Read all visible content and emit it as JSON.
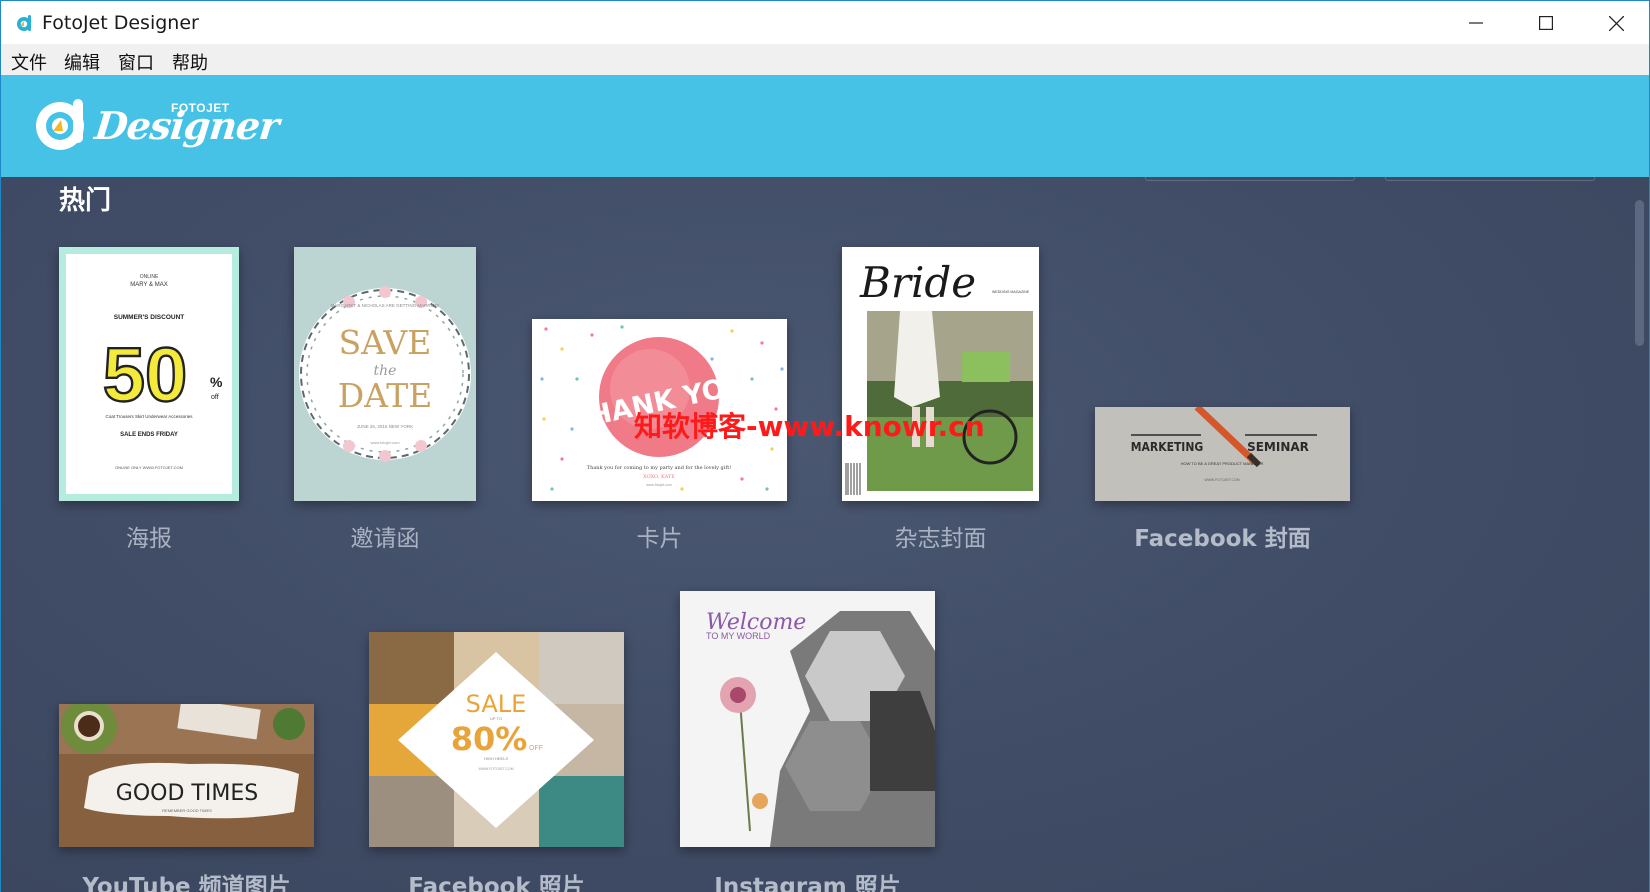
{
  "window": {
    "title": "FotoJet Designer",
    "controls": [
      "minimize",
      "maximize",
      "close"
    ]
  },
  "menu": {
    "items": [
      "文件",
      "编辑",
      "窗口",
      "帮助"
    ]
  },
  "brand": {
    "small_text": "FOTOJET",
    "script_text": "Designer"
  },
  "section": {
    "title": "热门"
  },
  "templates": [
    {
      "label": "海报",
      "thumb": {
        "line1": "ONLINE",
        "line2": "MARY & MAX",
        "line3": "SUMMER'S DISCOUNT",
        "big": "50",
        "percent": "%",
        "off": "off",
        "line4": "Coat  Trousers  Skirt  Underwear  Accessories",
        "line5": "SALE ENDS FRIDAY",
        "line6": "ONLINE ONLY WWW.FOTOJET.COM"
      }
    },
    {
      "label": "邀请函",
      "thumb": {
        "top": "MARGARET & NICHOLAS ARE GETTING MARRIED!",
        "save": "SAVE",
        "the": "the",
        "date": "DATE",
        "when": "JUNE 25, 2016 NEW YORK",
        "site": "www.fotojet.com"
      }
    },
    {
      "label": "卡片",
      "thumb": {
        "big": "THANK YOU",
        "note": "Thank you for coming to my party and for the lovely gift!",
        "sign": "XOXO, KATE",
        "site": "www.fotojet.com"
      }
    },
    {
      "label": "杂志封面",
      "thumb": {
        "title": "Bride",
        "issue": "WEDDING MAGAZINE"
      }
    },
    {
      "label": "Facebook 封面",
      "thumb": {
        "left": "MARKETING",
        "right": "SEMINAR",
        "sub": "HOW TO BE A GREAT PRODUCT MANAGER",
        "site": "WWW.FOTOJET.COM"
      }
    },
    {
      "label": "YouTube 频道图片",
      "thumb": {
        "big": "GOOD TIMES",
        "sub": "REMEMBER GOOD TIMES"
      }
    },
    {
      "label": "Facebook 照片",
      "thumb": {
        "sale": "SALE",
        "upto": "UP TO",
        "pct": "80%",
        "off": "OFF",
        "sub": "HIGH HEELS",
        "site": "WWW.FOTOJET.COM"
      }
    },
    {
      "label": "Instagram 照片",
      "thumb": {
        "welcome": "Welcome",
        "sub": "TO MY WORLD"
      }
    }
  ],
  "watermark": "知软博客-www.knowr.cn",
  "colors": {
    "brand_bar": "#45c2e6",
    "content_bg": "#404c66",
    "label": "#aab2c2"
  }
}
